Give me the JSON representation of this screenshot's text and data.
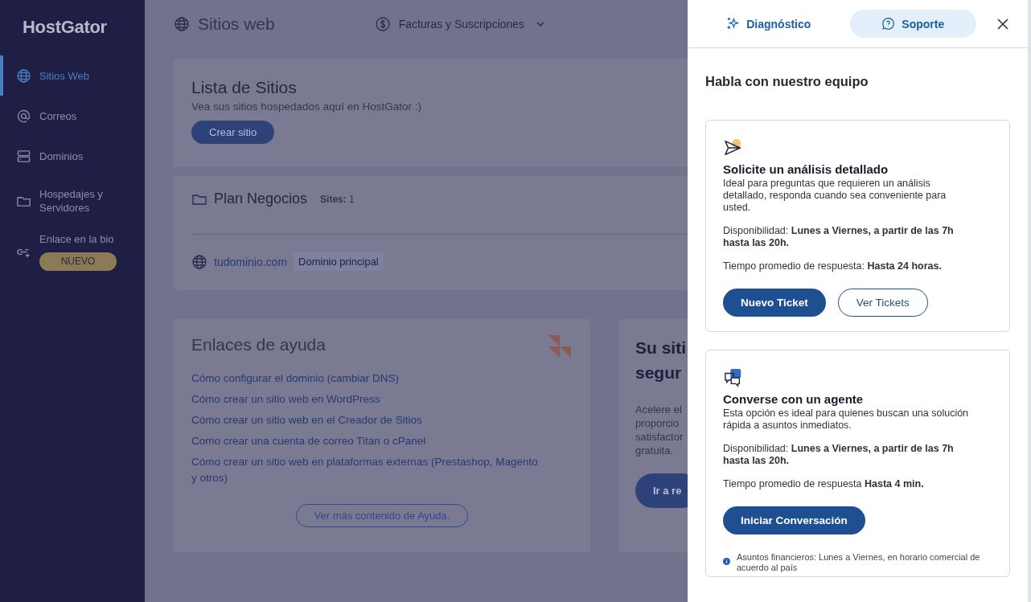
{
  "sidebar": {
    "logo": "HostGator",
    "items": [
      {
        "label": "Sitios Web",
        "selected": true
      },
      {
        "label": "Correos",
        "selected": false
      },
      {
        "label": "Dominios",
        "selected": false
      },
      {
        "label": "Hospedajes y Servidores",
        "selected": false
      },
      {
        "label": "Enlace en la bio",
        "selected": false,
        "badge": "NUEVO"
      }
    ]
  },
  "header": {
    "title": "Sitios web",
    "menu": "Facturas y Suscripciones"
  },
  "sites_card": {
    "title": "Lista de Sitios",
    "subtitle": "Vea sus sitios hospedados aquí en HostGator :)",
    "button": "Crear sitio"
  },
  "plan_card": {
    "name": "Plan Negocios",
    "sites_label": "Sites:",
    "sites_count": "1",
    "domain": "tudominio.com",
    "domain_tag": "Dominio principal"
  },
  "help_card": {
    "title": "Enlaces de ayuda",
    "links": [
      "Cómo configurar el dominio (cambiar DNS)",
      "Cómo crear un sitio web en WordPress",
      "Cómo crear un sitio web en el Creador de Sitios",
      "Como crear una cuenta de correo Titan o cPanel",
      "Cómo crear un sitio web en plataformas externas (Prestashop, Magento y otros)"
    ],
    "button": "Ver más contenido de Ayuda."
  },
  "promo_card": {
    "title_lines": [
      "Su siti",
      "segur"
    ],
    "text_lines": [
      "Acelere el",
      "proporcio",
      "satisfactor",
      "gratuita."
    ],
    "button": "Ir a re"
  },
  "support_panel": {
    "tabs": [
      {
        "label": "Diagnóstico",
        "selected": false
      },
      {
        "label": "Soporte",
        "selected": true
      }
    ],
    "heading": "Habla con nuestro equipo",
    "options": [
      {
        "kind": "ticket",
        "title": "Solicite un análisis detallado",
        "description": "Ideal para preguntas que requieren un análisis detallado, responda cuando sea conveniente para usted.",
        "availability": "Disponibilidad: **Lunes a Viernes, a partir de las 7h hasta las 20h.**",
        "response": "Tiempo promedio de respuesta: **Hasta 24 horas.**",
        "buttons": [
          {
            "label": "Nuevo Ticket",
            "kind": "primary"
          },
          {
            "label": "Ver Tickets",
            "kind": "outline"
          }
        ]
      },
      {
        "kind": "chat",
        "title": "Converse con un agente",
        "description": "Esta opción es ideal para quienes buscan una solución rápida a asuntos inmediatos.",
        "availability": "Disponibilidad: **Lunes a Viernes, a partir de las 7h hasta las 20h.**",
        "response": "Tiempo promedio de respuesta **Hasta 4 min.**",
        "buttons": [
          {
            "label": "Iniciar Conversación",
            "kind": "primary"
          }
        ],
        "note": "Asuntos financieros: Lunes a Viernes, en horario comercial de acuerdo al país"
      }
    ]
  }
}
